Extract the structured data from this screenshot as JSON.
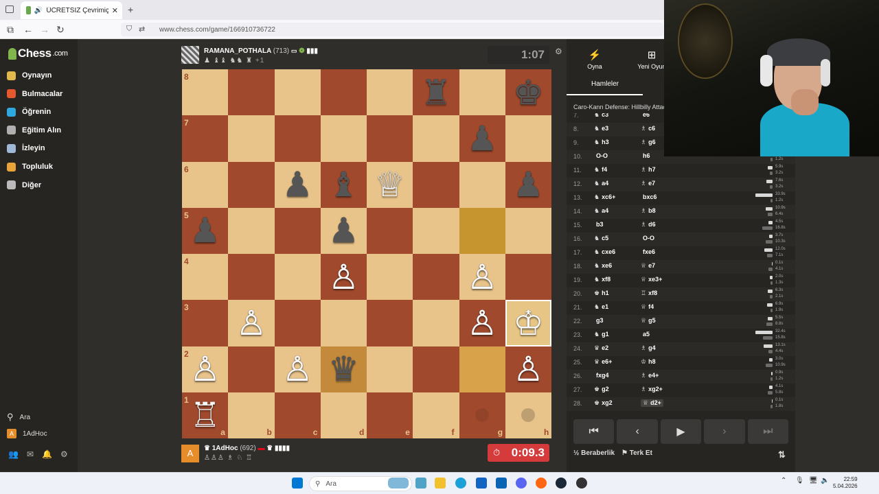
{
  "browser": {
    "tab_title": "ÜCRETSİZ Çevrimiçi Satranç",
    "url": "www.chess.com/game/166910736722"
  },
  "sidebar": {
    "logo": "Chess",
    "logo_suffix": ".com",
    "items": [
      {
        "label": "Oynayın",
        "icon": "play-icon",
        "color": "#e0b84c"
      },
      {
        "label": "Bulmacalar",
        "icon": "puzzle-icon",
        "color": "#e6582d"
      },
      {
        "label": "Öğrenin",
        "icon": "learn-icon",
        "color": "#2fa8e0"
      },
      {
        "label": "Eğitim Alın",
        "icon": "train-icon",
        "color": "#b0b0b0"
      },
      {
        "label": "İzleyin",
        "icon": "watch-icon",
        "color": "#9fb8d6"
      },
      {
        "label": "Topluluk",
        "icon": "community-icon",
        "color": "#e8a33a"
      },
      {
        "label": "Diğer",
        "icon": "more-icon",
        "color": "#bbbbbb"
      }
    ],
    "search_label": "Ara",
    "user_label": "1AdHoc",
    "user_initial": "A"
  },
  "game": {
    "top_player": {
      "name": "RAMANA_POTHALA",
      "rating": "(713)",
      "captured": "♟ ♝♝ ♞♞ ♜",
      "score": "+1"
    },
    "bottom_player": {
      "name": "1AdHoc",
      "rating": "(692)",
      "captured": "♙♙♙ ♗ ♘ ♖"
    },
    "top_clock": "1:07",
    "bottom_clock": "0:09.3",
    "files": [
      "a",
      "b",
      "c",
      "d",
      "e",
      "f",
      "g",
      "h"
    ],
    "ranks": [
      "8",
      "7",
      "6",
      "5",
      "4",
      "3",
      "2",
      "1"
    ],
    "pieces": [
      {
        "sq": "f8",
        "p": "♜",
        "c": "b"
      },
      {
        "sq": "h8",
        "p": "♚",
        "c": "b"
      },
      {
        "sq": "g7",
        "p": "♟",
        "c": "b"
      },
      {
        "sq": "c6",
        "p": "♟",
        "c": "b"
      },
      {
        "sq": "d6",
        "p": "♝",
        "c": "b"
      },
      {
        "sq": "e6",
        "p": "♕",
        "c": "w"
      },
      {
        "sq": "h6",
        "p": "♟",
        "c": "b"
      },
      {
        "sq": "a5",
        "p": "♟",
        "c": "b"
      },
      {
        "sq": "d5",
        "p": "♟",
        "c": "b"
      },
      {
        "sq": "d4",
        "p": "♙",
        "c": "w"
      },
      {
        "sq": "g4",
        "p": "♙",
        "c": "w"
      },
      {
        "sq": "b3",
        "p": "♙",
        "c": "w"
      },
      {
        "sq": "g3",
        "p": "♙",
        "c": "w"
      },
      {
        "sq": "h3",
        "p": "♔",
        "c": "w"
      },
      {
        "sq": "a2",
        "p": "♙",
        "c": "w"
      },
      {
        "sq": "c2",
        "p": "♙",
        "c": "w"
      },
      {
        "sq": "d2",
        "p": "♛",
        "c": "b"
      },
      {
        "sq": "h2",
        "p": "♙",
        "c": "w"
      },
      {
        "sq": "a1",
        "p": "♖",
        "c": "w"
      }
    ]
  },
  "panel": {
    "tab_play": "Oyna",
    "tab_new": "Yeni Oyun",
    "moves_tab": "Hamleler",
    "opening": "Caro-Kann Defense: Hillbilly Attack",
    "moves": [
      {
        "n": "7.",
        "w": "c3",
        "wp": "♞",
        "b": "e6",
        "bp": "",
        "tw": "",
        "tb": ""
      },
      {
        "n": "8.",
        "w": "e3",
        "wp": "♞",
        "b": "c6",
        "bp": "♗",
        "tw": "",
        "tb": ""
      },
      {
        "n": "9.",
        "w": "h3",
        "wp": "♞",
        "b": "g6",
        "bp": "♗",
        "tw": "",
        "tb": ""
      },
      {
        "n": "10.",
        "w": "O-O",
        "wp": "",
        "b": "h6",
        "bp": "",
        "tw": "2.6s",
        "tb": "1.2s",
        "fw": 0.18,
        "fb": 0.1
      },
      {
        "n": "11.",
        "w": "f4",
        "wp": "♞",
        "b": "h7",
        "bp": "♗",
        "tw": "5.9s",
        "tb": "3.2s",
        "fw": 0.25,
        "fb": 0.15
      },
      {
        "n": "12.",
        "w": "a4",
        "wp": "♞",
        "b": "e7",
        "bp": "♗",
        "tw": "7.6s",
        "tb": "3.2s",
        "fw": 0.3,
        "fb": 0.15
      },
      {
        "n": "13.",
        "w": "xc6+",
        "wp": "♞",
        "b": "bxc6",
        "bp": "",
        "tw": "33.9s",
        "tb": "1.2s",
        "fw": 0.85,
        "fb": 0.1
      },
      {
        "n": "14.",
        "w": "a4",
        "wp": "♞",
        "b": "b8",
        "bp": "♗",
        "tw": "10.9s",
        "tb": "6.4s",
        "fw": 0.35,
        "fb": 0.25
      },
      {
        "n": "15.",
        "w": "b3",
        "wp": "",
        "b": "d6",
        "bp": "♗",
        "tw": "4.5s",
        "tb": "16.8s",
        "fw": 0.2,
        "fb": 0.5
      },
      {
        "n": "16.",
        "w": "c5",
        "wp": "♞",
        "b": "O-O",
        "bp": "",
        "tw": "3.7s",
        "tb": "10.3s",
        "fw": 0.18,
        "fb": 0.35
      },
      {
        "n": "17.",
        "w": "cxe6",
        "wp": "♞",
        "b": "fxe6",
        "bp": "",
        "tw": "12.0s",
        "tb": "7.1s",
        "fw": 0.4,
        "fb": 0.28
      },
      {
        "n": "18.",
        "w": "xe6",
        "wp": "♞",
        "b": "e7",
        "bp": "♕",
        "tw": "0.1s",
        "tb": "4.1s",
        "fw": 0.05,
        "fb": 0.2
      },
      {
        "n": "19.",
        "w": "xf8",
        "wp": "♞",
        "b": "xe3+",
        "bp": "♕",
        "tw": "2.0s",
        "tb": "1.3s",
        "fw": 0.12,
        "fb": 0.1
      },
      {
        "n": "20.",
        "w": "h1",
        "wp": "♚",
        "b": "xf8",
        "bp": "♖",
        "tw": "6.3s",
        "tb": "2.1s",
        "fw": 0.25,
        "fb": 0.12
      },
      {
        "n": "21.",
        "w": "e1",
        "wp": "♞",
        "b": "f4",
        "bp": "♕",
        "tw": "6.9s",
        "tb": "1.9s",
        "fw": 0.27,
        "fb": 0.1
      },
      {
        "n": "22.",
        "w": "g3",
        "wp": "",
        "b": "g5",
        "bp": "♕",
        "tw": "5.5s",
        "tb": "8.8s",
        "fw": 0.22,
        "fb": 0.3
      },
      {
        "n": "23.",
        "w": "g1",
        "wp": "♞",
        "b": "a5",
        "bp": "",
        "tw": "32.4s",
        "tb": "15.8s",
        "fw": 0.85,
        "fb": 0.48
      },
      {
        "n": "24.",
        "w": "e2",
        "wp": "♛",
        "b": "g4",
        "bp": "♗",
        "tw": "13.1s",
        "tb": "4.4s",
        "fw": 0.42,
        "fb": 0.2
      },
      {
        "n": "25.",
        "w": "e6+",
        "wp": "♛",
        "b": "h8",
        "bp": "♔",
        "tw": "3.0s",
        "tb": "10.9s",
        "fw": 0.16,
        "fb": 0.35
      },
      {
        "n": "26.",
        "w": "fxg4",
        "wp": "",
        "b": "e4+",
        "bp": "♗",
        "tw": "0.9s",
        "tb": "1.2s",
        "fw": 0.08,
        "fb": 0.1
      },
      {
        "n": "27.",
        "w": "g2",
        "wp": "♚",
        "b": "xg2+",
        "bp": "♗",
        "tw": "4.1s",
        "tb": "5.8s",
        "fw": 0.18,
        "fb": 0.24
      },
      {
        "n": "28.",
        "w": "xg2",
        "wp": "♚",
        "b": "d2+",
        "bp": "♕",
        "tw": "0.1s",
        "tb": "1.8s",
        "fw": 0.05,
        "fb": 0.1
      }
    ],
    "draw_label": "Beraberlik",
    "draw_prefix": "½",
    "resign_label": "Terk Et"
  },
  "taskbar": {
    "search": "Ara",
    "time": "22:59",
    "date": "5.04.2026"
  }
}
